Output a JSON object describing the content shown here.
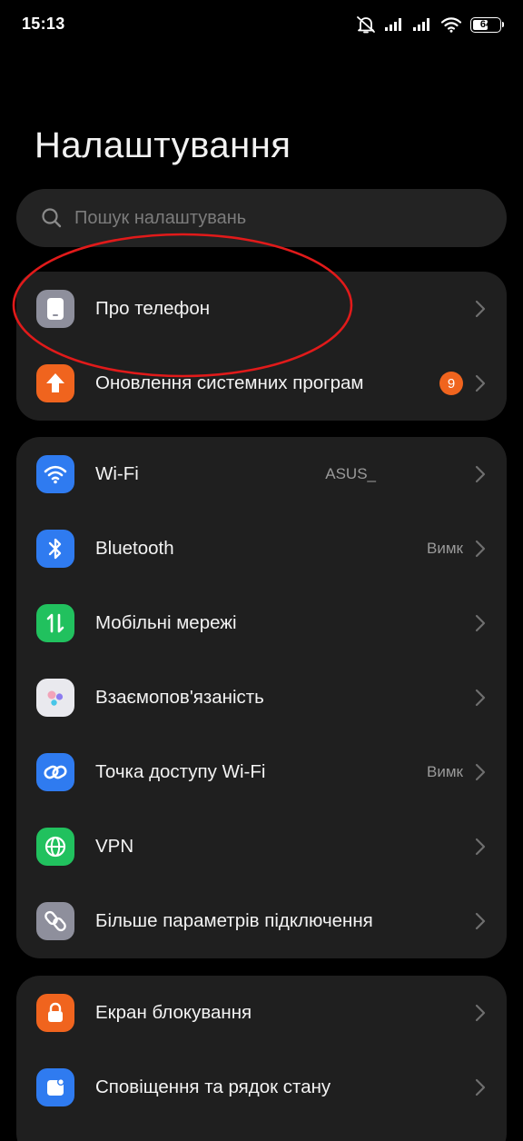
{
  "status_bar": {
    "time": "15:13",
    "battery": "64",
    "battery_level_percent": 64,
    "icons": [
      "mute-alarm-off-icon",
      "signal-icon",
      "signal-icon",
      "wifi-icon",
      "battery-icon"
    ]
  },
  "page": {
    "title": "Налаштування"
  },
  "search": {
    "placeholder": "Пошук налаштувань"
  },
  "groups": [
    {
      "items": [
        {
          "label": "Про телефон",
          "icon": "phone-icon",
          "color": "#8e8f9c",
          "value": ""
        },
        {
          "label": "Оновлення системних програм",
          "icon": "arrow-up-icon",
          "color": "#f0641e",
          "badge": "9"
        }
      ]
    },
    {
      "items": [
        {
          "label": "Wi-Fi",
          "icon": "wifi-icon",
          "color": "#2f7bf0",
          "value": "ASUS_"
        },
        {
          "label": "Bluetooth",
          "icon": "bluetooth-icon",
          "color": "#2f7bf0",
          "value": "Вимк"
        },
        {
          "label": "Мобільні мережі",
          "icon": "mobile-data-icon",
          "color": "#21c15e",
          "value": ""
        },
        {
          "label": "Взаємопов'язаність",
          "icon": "connectivity-icon",
          "color": "#e9e9ee",
          "value": ""
        },
        {
          "label": "Точка доступу Wi-Fi",
          "icon": "hotspot-icon",
          "color": "#2f7bf0",
          "value": "Вимк"
        },
        {
          "label": "VPN",
          "icon": "globe-icon",
          "color": "#21c15e",
          "value": ""
        },
        {
          "label": "Більше параметрів підключення",
          "icon": "link-icon",
          "color": "#8e8f9c",
          "value": ""
        }
      ]
    },
    {
      "items": [
        {
          "label": "Екран блокування",
          "icon": "lock-icon",
          "color": "#f0641e",
          "value": ""
        },
        {
          "label": "Сповіщення та рядок стану",
          "icon": "notification-icon",
          "color": "#2f7bf0",
          "value": ""
        }
      ]
    }
  ],
  "annotation": {
    "color": "#e11a1a",
    "target": "Про телефон"
  }
}
